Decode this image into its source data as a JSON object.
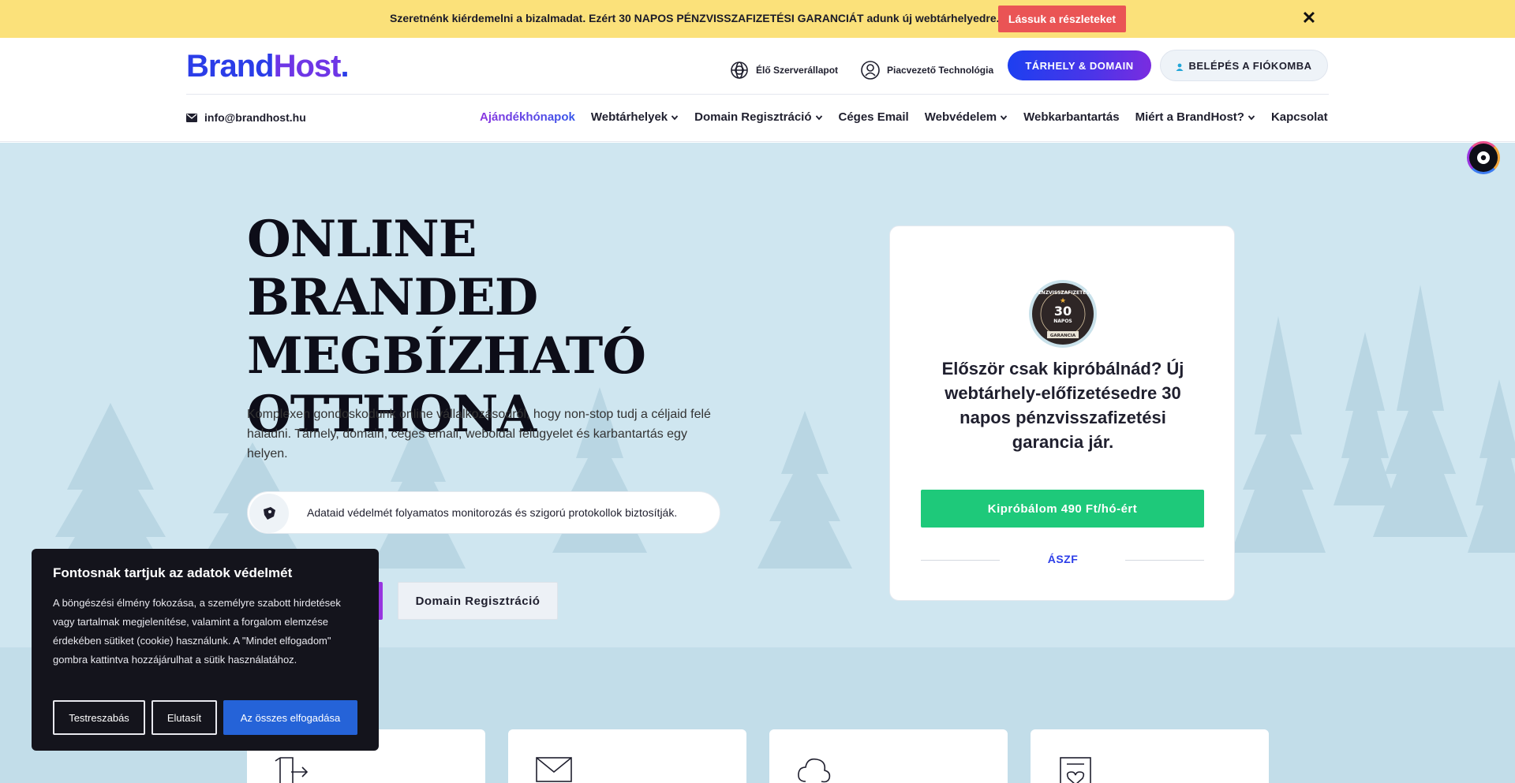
{
  "promo": {
    "text": "Szeretnénk kiérdemelni a bizalmadat. Ezért 30 NAPOS PÉNZVISSZAFIZETÉSI GARANCIÁT adunk új webtárhelyedre.",
    "button": "Lássuk a részleteket",
    "close_icon": "close-icon",
    "bg_color": "#fbe17a",
    "button_color": "#ea5455"
  },
  "header": {
    "logo_part1": "Brand",
    "logo_part2": "Host",
    "logo_dot": ".",
    "server_status": "Élő Szerverállapot",
    "technology": "Piacvezető Technológia",
    "hosting_button": "TÁRHELY & DOMAIN",
    "login_button": "BELÉPÉS A FIÓKOMBA",
    "email": "info@brandhost.hu"
  },
  "nav": [
    {
      "label": "Ajándékhónapok",
      "dropdown": false,
      "active": true
    },
    {
      "label": "Webtárhelyek",
      "dropdown": true
    },
    {
      "label": "Domain Regisztráció",
      "dropdown": true
    },
    {
      "label": "Céges Email",
      "dropdown": false
    },
    {
      "label": "Webvédelem",
      "dropdown": true
    },
    {
      "label": "Webkarbantartás",
      "dropdown": false
    },
    {
      "label": "Miért a BrandHost?",
      "dropdown": true
    },
    {
      "label": "Kapcsolat",
      "dropdown": false
    }
  ],
  "hero": {
    "title_line1": "ONLINE BRANDED",
    "title_line2": "MEGBÍZHATÓ",
    "title_line3": "OTTHONA",
    "description": "Komplexen gondoskodunk online vállalkozásodról, hogy non-stop tudj a céljaid felé haladni. Tárhely, domain, céges email, weboldal felügyelet és karbantartás egy helyen.",
    "security_text": "Adataid védelmét folyamatos monitorozás és szigorú protokollok biztosítják.",
    "domain_button": "Domain Regisztráció"
  },
  "card": {
    "badge_top": "PÉNZVISSZAFIZETÉSI",
    "badge_number": "30",
    "badge_word": "NAPOS",
    "badge_bottom": "GARANCIA",
    "title": "Először csak kipróbálnád? Új webtárhely-előfizetésedre 30 napos pénzvisszafizetési garancia jár.",
    "button": "Kipróbálom 490 Ft/hó-ért",
    "link": "ÁSZF"
  },
  "cookie": {
    "title": "Fontosnak tartjuk az adatok védelmét",
    "text": "A böngészési élmény fokozása, a személyre szabott hirdetések vagy tartalmak megjelenítése, valamint a forgalom elemzése érdekében sütiket (cookie) használunk. A \"Mindet elfogadom\" gombra kattintva hozzájárulhat a sütik használatához.",
    "customize": "Testreszabás",
    "reject": "Elutasít",
    "accept_all": "Az összes elfogadása"
  },
  "colors": {
    "brand_blue": "#2b3de8",
    "brand_purple": "#6e36e6",
    "hero_bg": "#cfe6f0",
    "green": "#1ec97a"
  }
}
